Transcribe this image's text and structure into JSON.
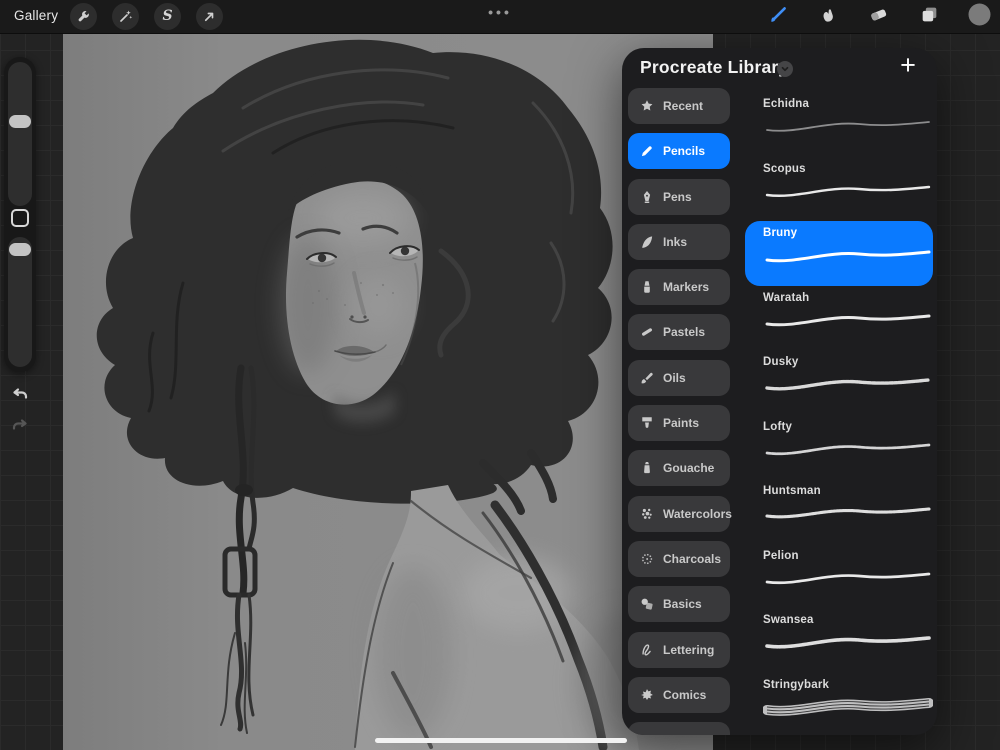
{
  "toolbar": {
    "gallery_label": "Gallery",
    "more_dots": "•••",
    "selection_glyph": "S",
    "left_tools": [
      "actions-wrench",
      "adjustments-wand",
      "selection-s",
      "transform-arrow"
    ],
    "right_tools": [
      "paint-brush",
      "smudge-finger",
      "eraser",
      "layers",
      "color-swatch"
    ],
    "active_tool": "paint-brush"
  },
  "library": {
    "title": "Procreate Library",
    "add_button": "+",
    "categories": [
      {
        "label": "Recent",
        "icon": "star-icon",
        "selected": false
      },
      {
        "label": "Pencils",
        "icon": "pencil-icon",
        "selected": true
      },
      {
        "label": "Pens",
        "icon": "pen-nib-icon",
        "selected": false
      },
      {
        "label": "Inks",
        "icon": "quill-icon",
        "selected": false
      },
      {
        "label": "Markers",
        "icon": "marker-icon",
        "selected": false
      },
      {
        "label": "Pastels",
        "icon": "pastel-stick-icon",
        "selected": false
      },
      {
        "label": "Oils",
        "icon": "oil-brush-icon",
        "selected": false
      },
      {
        "label": "Paints",
        "icon": "paint-brush-icon",
        "selected": false
      },
      {
        "label": "Gouache",
        "icon": "paint-tube-icon",
        "selected": false
      },
      {
        "label": "Watercolors",
        "icon": "water-dots-icon",
        "selected": false
      },
      {
        "label": "Charcoals",
        "icon": "charcoal-dots-icon",
        "selected": false
      },
      {
        "label": "Basics",
        "icon": "shapes-icon",
        "selected": false
      },
      {
        "label": "Lettering",
        "icon": "script-icon",
        "selected": false
      },
      {
        "label": "Comics",
        "icon": "burst-icon",
        "selected": false
      }
    ],
    "brushes": [
      {
        "name": "Echidna",
        "selected": false
      },
      {
        "name": "Scopus",
        "selected": false
      },
      {
        "name": "Bruny",
        "selected": true
      },
      {
        "name": "Waratah",
        "selected": false
      },
      {
        "name": "Dusky",
        "selected": false
      },
      {
        "name": "Lofty",
        "selected": false
      },
      {
        "name": "Huntsman",
        "selected": false
      },
      {
        "name": "Pelion",
        "selected": false
      },
      {
        "name": "Swansea",
        "selected": false
      },
      {
        "name": "Stringybark",
        "selected": false
      }
    ]
  },
  "colors": {
    "accent_blue": "#0A7AFF",
    "panel_bg": "#1D1D1F",
    "category_chip_bg": "#39393B",
    "toolbar_bg": "#1A1A1A",
    "canvas_gray": "#8A8A8A"
  }
}
